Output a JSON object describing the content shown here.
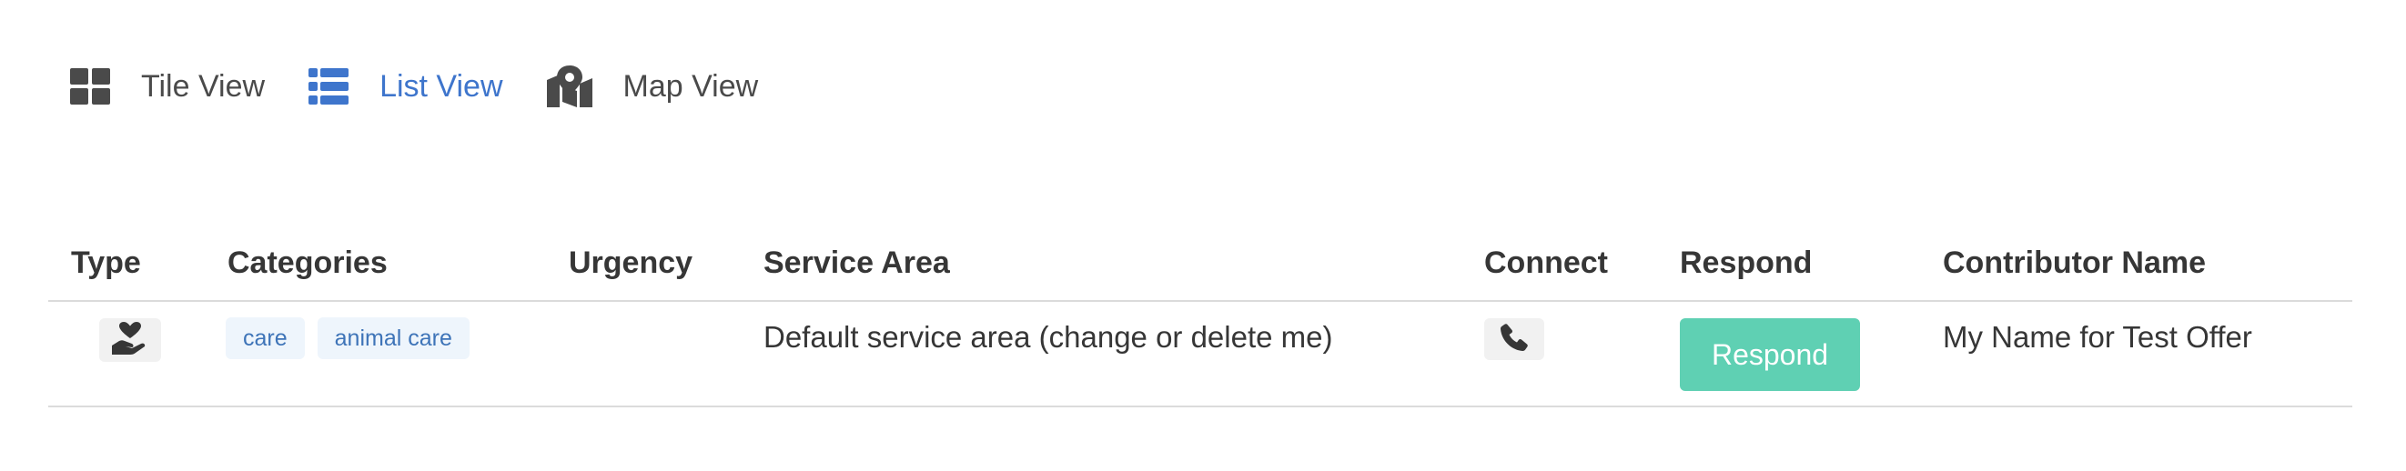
{
  "views": {
    "tile": {
      "label": "Tile View",
      "icon": "grid-icon"
    },
    "list": {
      "label": "List View",
      "icon": "list-icon",
      "active": true
    },
    "map": {
      "label": "Map View",
      "icon": "map-icon"
    }
  },
  "colors": {
    "accent": "#3e75cc",
    "respond_button": "#5fd0b3",
    "tag_background": "#eef5fc",
    "tag_text": "#3e74b8"
  },
  "table": {
    "headers": {
      "type": "Type",
      "categories": "Categories",
      "urgency": "Urgency",
      "service_area": "Service Area",
      "connect": "Connect",
      "respond": "Respond",
      "contributor": "Contributor Name"
    },
    "rows": [
      {
        "type_icon": "hand-heart-icon",
        "categories": [
          "care",
          "animal care"
        ],
        "urgency": "",
        "service_area": "Default service area (change or delete me)",
        "connect_icon": "phone-icon",
        "respond_label": "Respond",
        "contributor": "My Name for Test Offer"
      }
    ]
  }
}
